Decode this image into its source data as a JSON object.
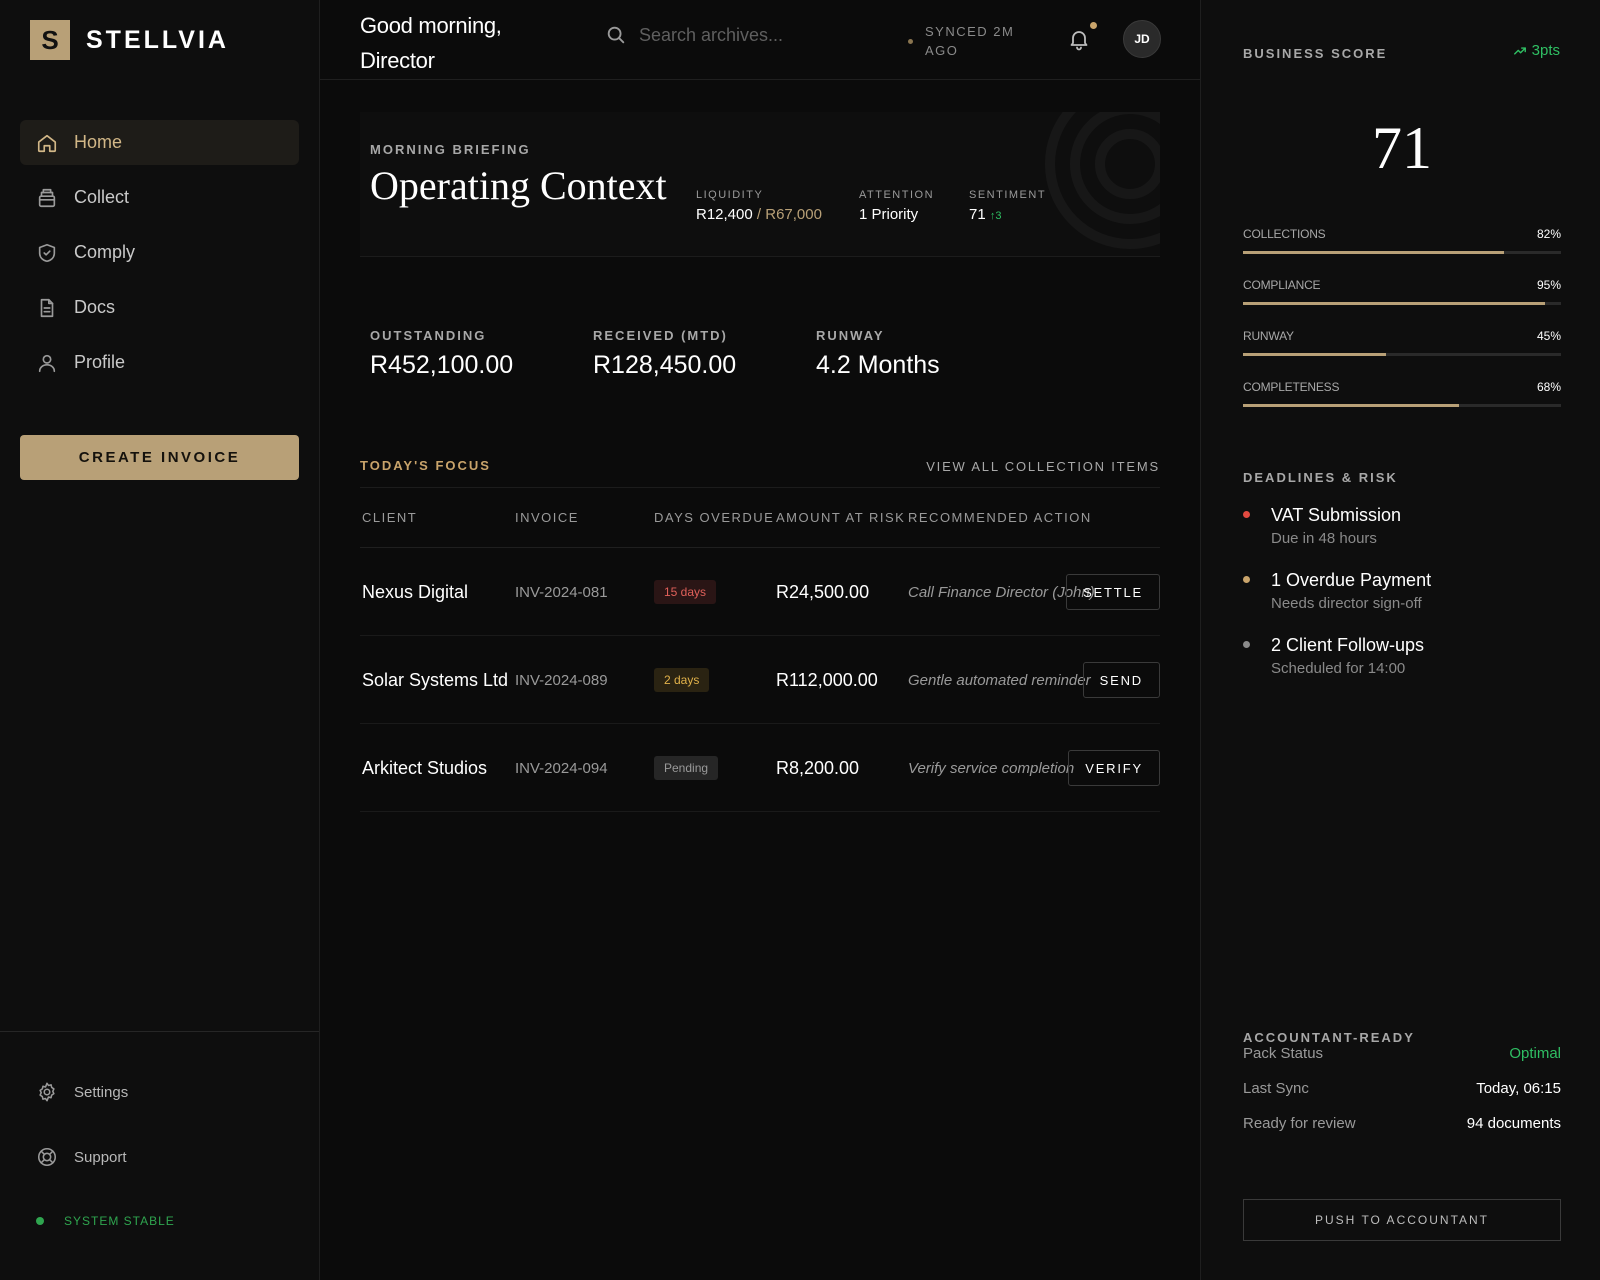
{
  "brand": {
    "mark": "S",
    "name": "STELLVIA"
  },
  "nav": [
    {
      "label": "Home",
      "icon": "home-icon",
      "active": true
    },
    {
      "label": "Collect",
      "icon": "collect-icon"
    },
    {
      "label": "Comply",
      "icon": "shield-icon"
    },
    {
      "label": "Docs",
      "icon": "document-icon"
    },
    {
      "label": "Profile",
      "icon": "user-icon"
    }
  ],
  "create_invoice": "CREATE INVOICE",
  "sidebar_bottom": {
    "settings": "Settings",
    "support": "Support",
    "status": "SYSTEM STABLE"
  },
  "header": {
    "greeting": "Good morning, Director",
    "search_placeholder": "Search archives...",
    "synced": "SYNCED 2M AGO",
    "avatar": "JD"
  },
  "briefing": {
    "eyebrow": "MORNING BRIEFING",
    "title": "Operating Context",
    "liquidity": {
      "label": "LIQUIDITY",
      "value": "R12,400",
      "sep": " / ",
      "target": "R67,000"
    },
    "attention": {
      "label": "ATTENTION",
      "value": "1 Priority"
    },
    "sentiment": {
      "label": "SENTIMENT",
      "value": "71",
      "delta": "↑3"
    }
  },
  "kpis": [
    {
      "label": "OUTSTANDING",
      "value": "R452,100.00"
    },
    {
      "label": "RECEIVED (MTD)",
      "value": "R128,450.00"
    },
    {
      "label": "RUNWAY",
      "value": "4.2 Months"
    }
  ],
  "focus": {
    "title": "TODAY'S FOCUS",
    "view_all": "VIEW ALL COLLECTION ITEMS",
    "columns": [
      "CLIENT",
      "INVOICE",
      "DAYS OVERDUE",
      "AMOUNT AT RISK",
      "RECOMMENDED ACTION"
    ],
    "rows": [
      {
        "client": "Nexus Digital",
        "invoice": "INV-2024-081",
        "days": "15 days",
        "amount": "R24,500.00",
        "action": "Call Finance Director (John)",
        "button": "SETTLE"
      },
      {
        "client": "Solar Systems Ltd",
        "invoice": "INV-2024-089",
        "days": "2 days",
        "amount": "R112,000.00",
        "action": "Gentle automated reminder",
        "button": "SEND"
      },
      {
        "client": "Arkitect Studios",
        "invoice": "INV-2024-094",
        "days": "Pending",
        "amount": "R8,200.00",
        "action": "Verify service completion",
        "button": "VERIFY"
      }
    ]
  },
  "score": {
    "title": "BUSINESS SCORE",
    "trend": "3pts",
    "value": "71",
    "bars": [
      {
        "label": "COLLECTIONS",
        "pct": "82%",
        "level": 82
      },
      {
        "label": "COMPLIANCE",
        "pct": "95%",
        "level": 95
      },
      {
        "label": "RUNWAY",
        "pct": "45%",
        "level": 45
      },
      {
        "label": "COMPLETENESS",
        "pct": "68%",
        "level": 68
      }
    ]
  },
  "deadlines": {
    "title": "DEADLINES & RISK",
    "items": [
      {
        "title": "VAT Submission",
        "sub": "Due in 48 hours",
        "color": "#e24a40"
      },
      {
        "title": "1 Overdue Payment",
        "sub": "Needs director sign-off",
        "color": "#c9a46b"
      },
      {
        "title": "2 Client Follow-ups",
        "sub": "Scheduled for 14:00",
        "color": "#8a8a8a"
      }
    ]
  },
  "accountant": {
    "title": "ACCOUNTANT-READY",
    "rows": [
      {
        "key": "Pack Status",
        "value": "Optimal"
      },
      {
        "key": "Last Sync",
        "value": "Today, 06:15"
      },
      {
        "key": "Ready for review",
        "value": "94 documents"
      }
    ],
    "button": "PUSH TO ACCOUNTANT"
  },
  "colors": {
    "accent": "#b8a077",
    "positive": "#2fbf63",
    "danger": "#e24a40",
    "warning": "#e0b14a"
  }
}
